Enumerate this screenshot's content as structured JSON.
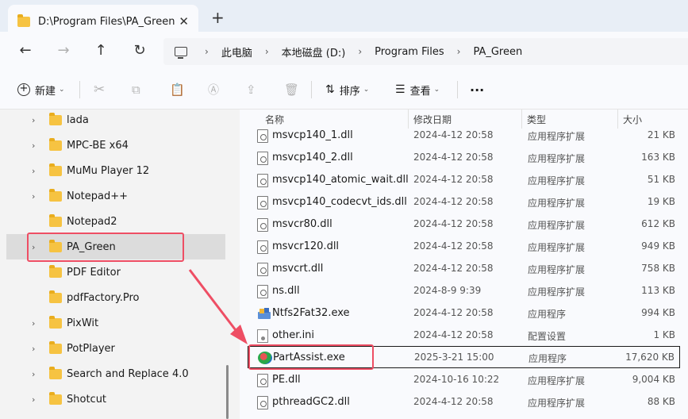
{
  "tab": {
    "title": "D:\\Program Files\\PA_Green",
    "close": "✕",
    "new_tab": "+"
  },
  "nav": {
    "back": "←",
    "forward": "→",
    "up": "↑",
    "refresh": "↻"
  },
  "breadcrumb": [
    "此电脑",
    "本地磁盘 (D:)",
    "Program Files",
    "PA_Green"
  ],
  "toolbar": {
    "new_label": "新建",
    "sort_label": "排序",
    "view_label": "查看",
    "more": "···"
  },
  "sidebar": {
    "items": [
      {
        "label": "lada",
        "expandable": true
      },
      {
        "label": "MPC-BE x64",
        "expandable": true
      },
      {
        "label": "MuMu Player 12",
        "expandable": true
      },
      {
        "label": "Notepad++",
        "expandable": true
      },
      {
        "label": "Notepad2",
        "expandable": false
      },
      {
        "label": "PA_Green",
        "expandable": true,
        "selected": true
      },
      {
        "label": "PDF Editor",
        "expandable": false
      },
      {
        "label": "pdfFactory.Pro",
        "expandable": false
      },
      {
        "label": "PixWit",
        "expandable": true
      },
      {
        "label": "PotPlayer",
        "expandable": true
      },
      {
        "label": "Search and Replace 4.0",
        "expandable": true
      },
      {
        "label": "Shotcut",
        "expandable": true
      }
    ]
  },
  "columns": {
    "name": "名称",
    "date": "修改日期",
    "type": "类型",
    "size": "大小"
  },
  "files": [
    {
      "name": "msvcp140_1.dll",
      "date": "2024-4-12 20:58",
      "type": "应用程序扩展",
      "size": "21 KB",
      "icon": "dll-icon"
    },
    {
      "name": "msvcp140_2.dll",
      "date": "2024-4-12 20:58",
      "type": "应用程序扩展",
      "size": "163 KB",
      "icon": "dll-icon"
    },
    {
      "name": "msvcp140_atomic_wait.dll",
      "date": "2024-4-12 20:58",
      "type": "应用程序扩展",
      "size": "51 KB",
      "icon": "dll-icon"
    },
    {
      "name": "msvcp140_codecvt_ids.dll",
      "date": "2024-4-12 20:58",
      "type": "应用程序扩展",
      "size": "19 KB",
      "icon": "dll-icon"
    },
    {
      "name": "msvcr80.dll",
      "date": "2024-4-12 20:58",
      "type": "应用程序扩展",
      "size": "612 KB",
      "icon": "dll-icon"
    },
    {
      "name": "msvcr120.dll",
      "date": "2024-4-12 20:58",
      "type": "应用程序扩展",
      "size": "949 KB",
      "icon": "dll-icon"
    },
    {
      "name": "msvcrt.dll",
      "date": "2024-4-12 20:58",
      "type": "应用程序扩展",
      "size": "758 KB",
      "icon": "dll-icon"
    },
    {
      "name": "ns.dll",
      "date": "2024-8-9 9:39",
      "type": "应用程序扩展",
      "size": "113 KB",
      "icon": "dll-icon"
    },
    {
      "name": "Ntfs2Fat32.exe",
      "date": "2024-4-12 20:58",
      "type": "应用程序",
      "size": "994 KB",
      "icon": "exe-icon"
    },
    {
      "name": "other.ini",
      "date": "2024-4-12 20:58",
      "type": "配置设置",
      "size": "1 KB",
      "icon": "ini-icon"
    },
    {
      "name": "PartAssist.exe",
      "date": "2025-3-21 15:00",
      "type": "应用程序",
      "size": "17,620 KB",
      "icon": "partassist-icon",
      "selected": true
    },
    {
      "name": "PE.dll",
      "date": "2024-10-16 10:22",
      "type": "应用程序扩展",
      "size": "9,004 KB",
      "icon": "dll-icon"
    },
    {
      "name": "pthreadGC2.dll",
      "date": "2024-4-12 20:58",
      "type": "应用程序扩展",
      "size": "88 KB",
      "icon": "dll-icon"
    }
  ],
  "colors": {
    "highlight": "#ee4e64",
    "folder": "#f6c342"
  }
}
